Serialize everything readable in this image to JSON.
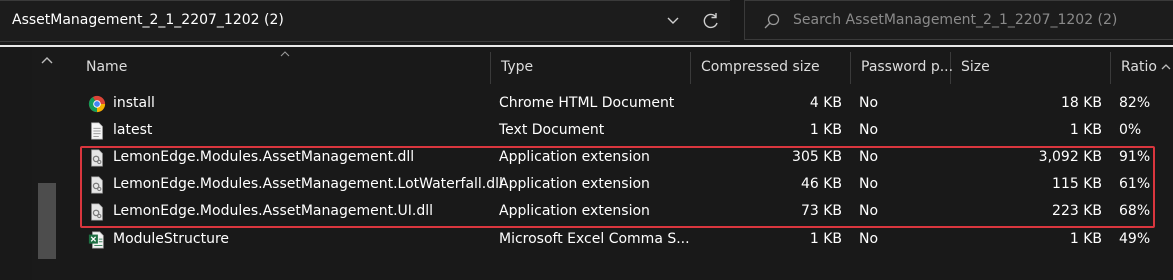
{
  "address_bar": {
    "path": "AssetManagement_2_1_2207_1202 (2)"
  },
  "search": {
    "placeholder": "Search AssetManagement_2_1_2207_1202 (2)"
  },
  "columns": {
    "name": "Name",
    "type": "Type",
    "compressed_size": "Compressed size",
    "password_protected": "Password p...",
    "size": "Size",
    "ratio": "Ratio"
  },
  "files": [
    {
      "icon": "chrome-icon",
      "name": "install",
      "type": "Chrome HTML Document",
      "compressed": "4 KB",
      "password": "No",
      "size": "18 KB",
      "ratio": "82%"
    },
    {
      "icon": "text-file-icon",
      "name": "latest",
      "type": "Text Document",
      "compressed": "1 KB",
      "password": "No",
      "size": "1 KB",
      "ratio": "0%"
    },
    {
      "icon": "dll-file-icon",
      "name": "LemonEdge.Modules.AssetManagement.dll",
      "type": "Application extension",
      "compressed": "305 KB",
      "password": "No",
      "size": "3,092 KB",
      "ratio": "91%"
    },
    {
      "icon": "dll-file-icon",
      "name": "LemonEdge.Modules.AssetManagement.LotWaterfall.dll",
      "type": "Application extension",
      "compressed": "46 KB",
      "password": "No",
      "size": "115 KB",
      "ratio": "61%"
    },
    {
      "icon": "dll-file-icon",
      "name": "LemonEdge.Modules.AssetManagement.UI.dll",
      "type": "Application extension",
      "compressed": "73 KB",
      "password": "No",
      "size": "223 KB",
      "ratio": "68%"
    },
    {
      "icon": "excel-csv-icon",
      "name": "ModuleStructure",
      "type": "Microsoft Excel Comma S...",
      "compressed": "1 KB",
      "password": "No",
      "size": "1 KB",
      "ratio": "49%"
    }
  ],
  "colors": {
    "background": "#191919",
    "highlight_border": "#d9363e",
    "text": "#ffffff",
    "placeholder": "#8a8a8a"
  }
}
